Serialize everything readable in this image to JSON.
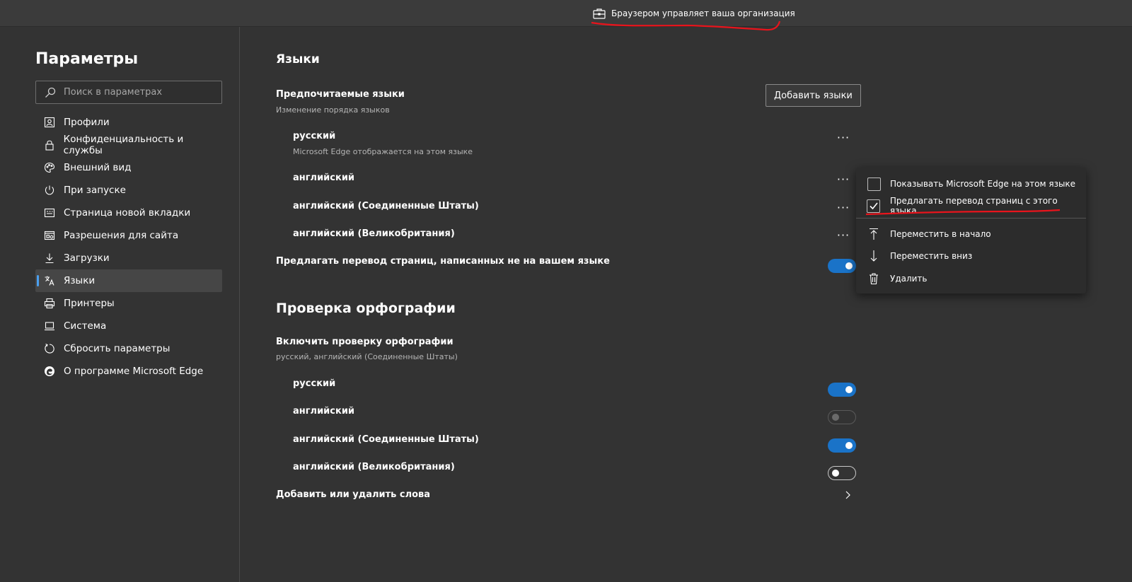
{
  "topbar": {
    "managed_text": "Браузером управляет ваша организация",
    "icon": "briefcase-icon"
  },
  "sidebar": {
    "title": "Параметры",
    "search_placeholder": "Поиск в параметрах",
    "items": [
      {
        "label": "Профили",
        "icon": "profile-icon"
      },
      {
        "label": "Конфиденциальность и службы",
        "icon": "lock-icon"
      },
      {
        "label": "Внешний вид",
        "icon": "palette-icon"
      },
      {
        "label": "При запуске",
        "icon": "power-icon"
      },
      {
        "label": "Страница новой вкладки",
        "icon": "new-tab-icon"
      },
      {
        "label": "Разрешения для сайта",
        "icon": "site-permissions-icon"
      },
      {
        "label": "Загрузки",
        "icon": "download-icon"
      },
      {
        "label": "Языки",
        "icon": "languages-icon",
        "active": true
      },
      {
        "label": "Принтеры",
        "icon": "printer-icon"
      },
      {
        "label": "Система",
        "icon": "laptop-icon"
      },
      {
        "label": "Сбросить параметры",
        "icon": "reset-icon"
      },
      {
        "label": "О программе Microsoft Edge",
        "icon": "edge-logo-icon"
      }
    ]
  },
  "languages": {
    "title": "Языки",
    "preferred_title": "Предпочитаемые языки",
    "preferred_sub": "Изменение порядка языков",
    "add_button": "Добавить языки",
    "list": [
      {
        "name": "русский",
        "note": "Microsoft Edge отображается на этом языке"
      },
      {
        "name": "английский"
      },
      {
        "name": "английский (Соединенные Штаты)"
      },
      {
        "name": "английский (Великобритания)"
      }
    ],
    "more_glyph": "···",
    "offer_translate_label": "Предлагать перевод страниц, написанных не на вашем языке",
    "offer_translate_on": true
  },
  "spellcheck": {
    "title": "Проверка орфографии",
    "enable_label": "Включить проверку орфографии",
    "enable_sub": "русский, английский (Соединенные Штаты)",
    "list": [
      {
        "name": "русский",
        "state": "on"
      },
      {
        "name": "английский",
        "state": "disabled"
      },
      {
        "name": "английский (Соединенные Штаты)",
        "state": "on"
      },
      {
        "name": "английский (Великобритания)",
        "state": "off"
      }
    ],
    "add_words_label": "Добавить или удалить слова"
  },
  "context_menu": {
    "show_in_lang": "Показывать Microsoft Edge на этом языке",
    "show_in_lang_checked": false,
    "offer_translate": "Предлагать перевод страниц с этого языка",
    "offer_translate_checked": true,
    "move_top": "Переместить в начало",
    "move_down": "Переместить вниз",
    "remove": "Удалить"
  },
  "colors": {
    "accent": "#1a73c8",
    "active_indicator": "#4aa0f0",
    "annotation": "#e8141c"
  }
}
